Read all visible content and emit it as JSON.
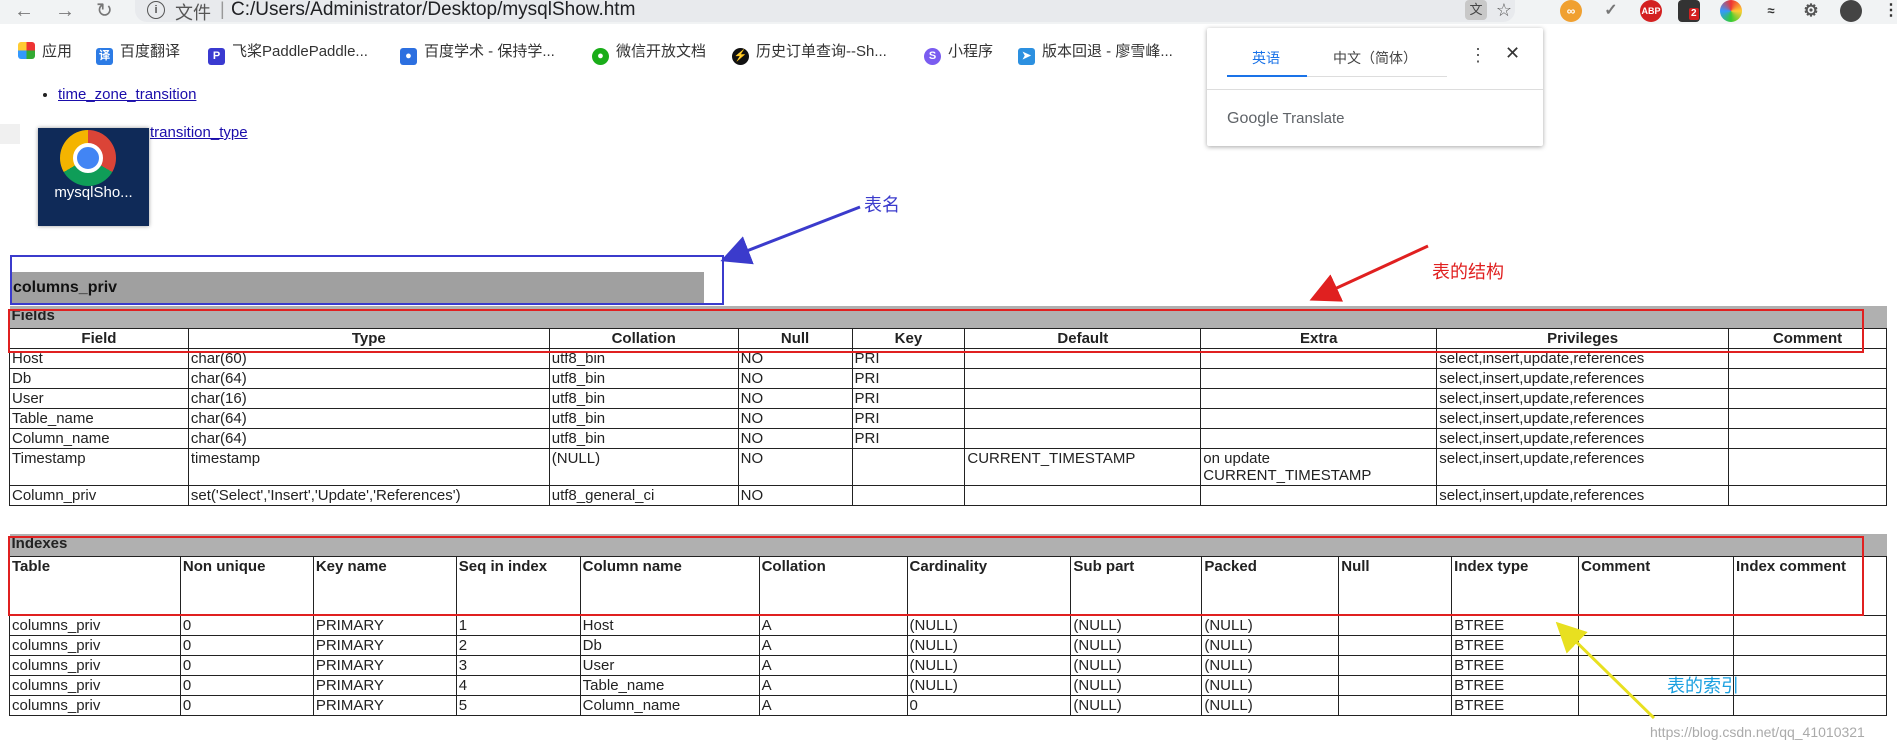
{
  "browser": {
    "omnibox_file_label": "文件",
    "url": "C:/Users/Administrator/Desktop/mysqlShow.htm",
    "bookmarks": [
      "应用",
      "百度翻译",
      "飞桨PaddlePaddle...",
      "百度学术 - 保持学...",
      "微信开放文档",
      "历史订单查询--Sh...",
      "小程序",
      "版本回退 - 廖雪峰..."
    ],
    "ext_badge": "2"
  },
  "translate_popup": {
    "tab_source": "英语",
    "tab_target": "中文（简体）",
    "footer_google": "Google",
    "footer_translate": "Translate"
  },
  "page": {
    "toc_links": [
      "time_zone_transition",
      "transition_type"
    ],
    "desktop_icon_label": "mysqlSho...",
    "table_name": "columns_priv"
  },
  "annotations": {
    "table_name_label": "表名",
    "structure_label": "表的结构",
    "index_label": "表的索引"
  },
  "fields": {
    "section_title": "Fields",
    "headers": [
      "Field",
      "Type",
      "Collation",
      "Null",
      "Key",
      "Default",
      "Extra",
      "Privileges",
      "Comment"
    ],
    "rows": [
      [
        "Host",
        "char(60)",
        "utf8_bin",
        "NO",
        "PRI",
        "",
        "",
        "select,insert,update,references",
        ""
      ],
      [
        "Db",
        "char(64)",
        "utf8_bin",
        "NO",
        "PRI",
        "",
        "",
        "select,insert,update,references",
        ""
      ],
      [
        "User",
        "char(16)",
        "utf8_bin",
        "NO",
        "PRI",
        "",
        "",
        "select,insert,update,references",
        ""
      ],
      [
        "Table_name",
        "char(64)",
        "utf8_bin",
        "NO",
        "PRI",
        "",
        "",
        "select,insert,update,references",
        ""
      ],
      [
        "Column_name",
        "char(64)",
        "utf8_bin",
        "NO",
        "PRI",
        "",
        "",
        "select,insert,update,references",
        ""
      ],
      [
        "Timestamp",
        "timestamp",
        "(NULL)",
        "NO",
        "",
        "CURRENT_TIMESTAMP",
        "on update CURRENT_TIMESTAMP",
        "select,insert,update,references",
        ""
      ],
      [
        "Column_priv",
        "set('Select','Insert','Update','References')",
        "utf8_general_ci",
        "NO",
        "",
        "",
        "",
        "select,insert,update,references",
        ""
      ]
    ]
  },
  "indexes": {
    "section_title": "Indexes",
    "headers": [
      "Table",
      "Non unique",
      "Key name",
      "Seq in index",
      "Column name",
      "Collation",
      "Cardinality",
      "Sub part",
      "Packed",
      "Null",
      "Index type",
      "Comment",
      "Index comment"
    ],
    "rows": [
      [
        "columns_priv",
        "0",
        "PRIMARY",
        "1",
        "Host",
        "A",
        "(NULL)",
        "(NULL)",
        "(NULL)",
        "",
        "BTREE",
        "",
        ""
      ],
      [
        "columns_priv",
        "0",
        "PRIMARY",
        "2",
        "Db",
        "A",
        "(NULL)",
        "(NULL)",
        "(NULL)",
        "",
        "BTREE",
        "",
        ""
      ],
      [
        "columns_priv",
        "0",
        "PRIMARY",
        "3",
        "User",
        "A",
        "(NULL)",
        "(NULL)",
        "(NULL)",
        "",
        "BTREE",
        "",
        ""
      ],
      [
        "columns_priv",
        "0",
        "PRIMARY",
        "4",
        "Table_name",
        "A",
        "(NULL)",
        "(NULL)",
        "(NULL)",
        "",
        "BTREE",
        "",
        ""
      ],
      [
        "columns_priv",
        "0",
        "PRIMARY",
        "5",
        "Column_name",
        "A",
        "0",
        "(NULL)",
        "(NULL)",
        "",
        "BTREE",
        "",
        ""
      ]
    ]
  },
  "watermark": "https://blog.csdn.net/qq_41010321",
  "colors": {
    "table_name_arrow": "#3b3bcc",
    "structure_arrow": "#e02020",
    "index_arrow": "#e8e020",
    "index_label": "#1aa0e0",
    "section_header_bg": "#b0b0b0"
  }
}
